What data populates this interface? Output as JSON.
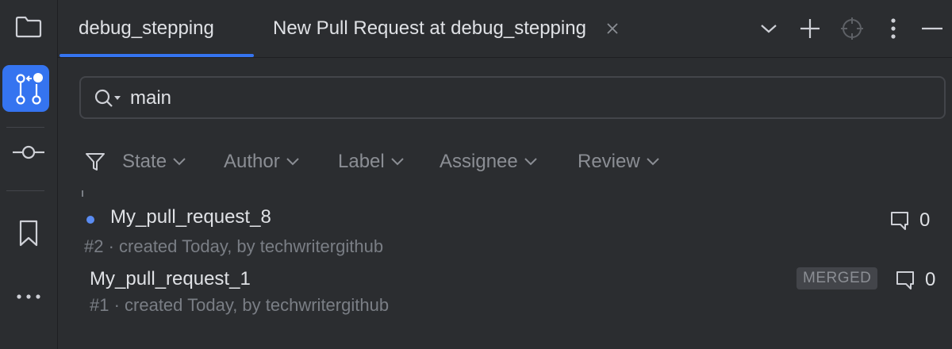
{
  "tabs": [
    {
      "label": "debug_stepping",
      "active": true
    },
    {
      "label": "New Pull Request at debug_stepping",
      "active": false
    }
  ],
  "search": {
    "value": "main"
  },
  "filters": [
    "State",
    "Author",
    "Label",
    "Assignee",
    "Review"
  ],
  "pull_requests": [
    {
      "title": "My_pull_request_8",
      "subtitle": "#2 · created Today, by techwritergithub",
      "comments": "0",
      "unread": true,
      "badge": ""
    },
    {
      "title": "My_pull_request_1",
      "subtitle": "#1 · created Today, by techwritergithub",
      "comments": "0",
      "unread": false,
      "badge": "MERGED"
    }
  ],
  "colors": {
    "accent": "#3574f0",
    "background": "#2b2d30",
    "unread_dot": "#5a8cf2"
  },
  "icons": [
    "folder-icon",
    "pull-requests-icon",
    "commit-icon",
    "bookmark-icon",
    "more-icon",
    "chevron-down-icon",
    "plus-icon",
    "target-icon",
    "vertical-dots-icon",
    "minimize-icon",
    "search-icon",
    "filter-icon",
    "comment-icon",
    "close-icon"
  ]
}
